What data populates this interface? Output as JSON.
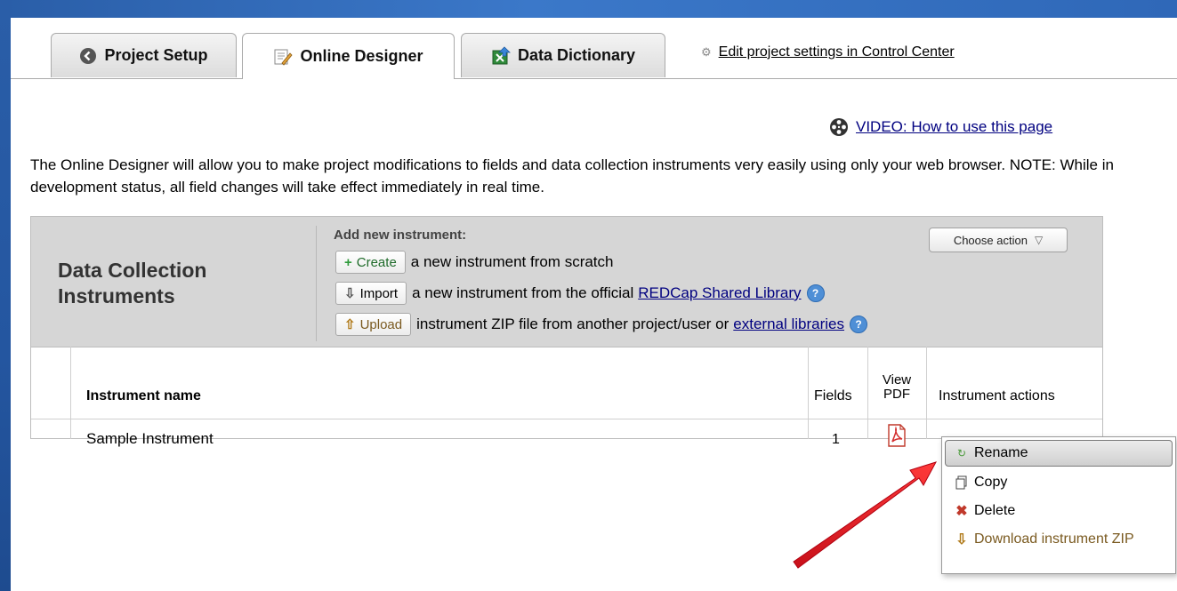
{
  "tabs": [
    {
      "label": "Project Setup",
      "icon": "back-circle-icon"
    },
    {
      "label": "Online Designer",
      "icon": "designer-pencil-icon"
    },
    {
      "label": "Data Dictionary",
      "icon": "spreadsheet-upload-icon"
    }
  ],
  "settings_link": "Edit project settings in Control Center",
  "video_link": "VIDEO: How to use this page",
  "intro_text": "The Online Designer will allow you to make project modifications to fields and data collection instruments very easily using only your web browser. NOTE: While in development status, all field changes will take effect immediately in real time.",
  "panel": {
    "title": "Data Collection Instruments",
    "add_title": "Add new instrument:",
    "create_label": "Create",
    "create_text": "a new instrument from scratch",
    "import_label": "Import",
    "import_text": "a new instrument from the official",
    "import_link": "REDCap Shared Library",
    "upload_label": "Upload",
    "upload_text": "instrument ZIP file from another project/user or",
    "upload_link": "external libraries"
  },
  "table": {
    "headers": {
      "name": "Instrument name",
      "fields": "Fields",
      "view_pdf_1": "View",
      "view_pdf_2": "PDF",
      "actions": "Instrument actions"
    },
    "rows": [
      {
        "name": "Sample Instrument",
        "fields": "1"
      }
    ]
  },
  "choose_action_label": "Choose action",
  "menu": {
    "items": [
      {
        "label": "Rename",
        "icon": "rename-icon"
      },
      {
        "label": "Copy",
        "icon": "copy-icon"
      },
      {
        "label": "Delete",
        "icon": "delete-icon"
      },
      {
        "label": "Download instrument ZIP",
        "icon": "download-icon"
      }
    ]
  },
  "colors": {
    "frame_blue": "#2f68b8",
    "panel_header": "#d6d6d6",
    "link": "#000080",
    "arrow_red": "#e8202a"
  }
}
